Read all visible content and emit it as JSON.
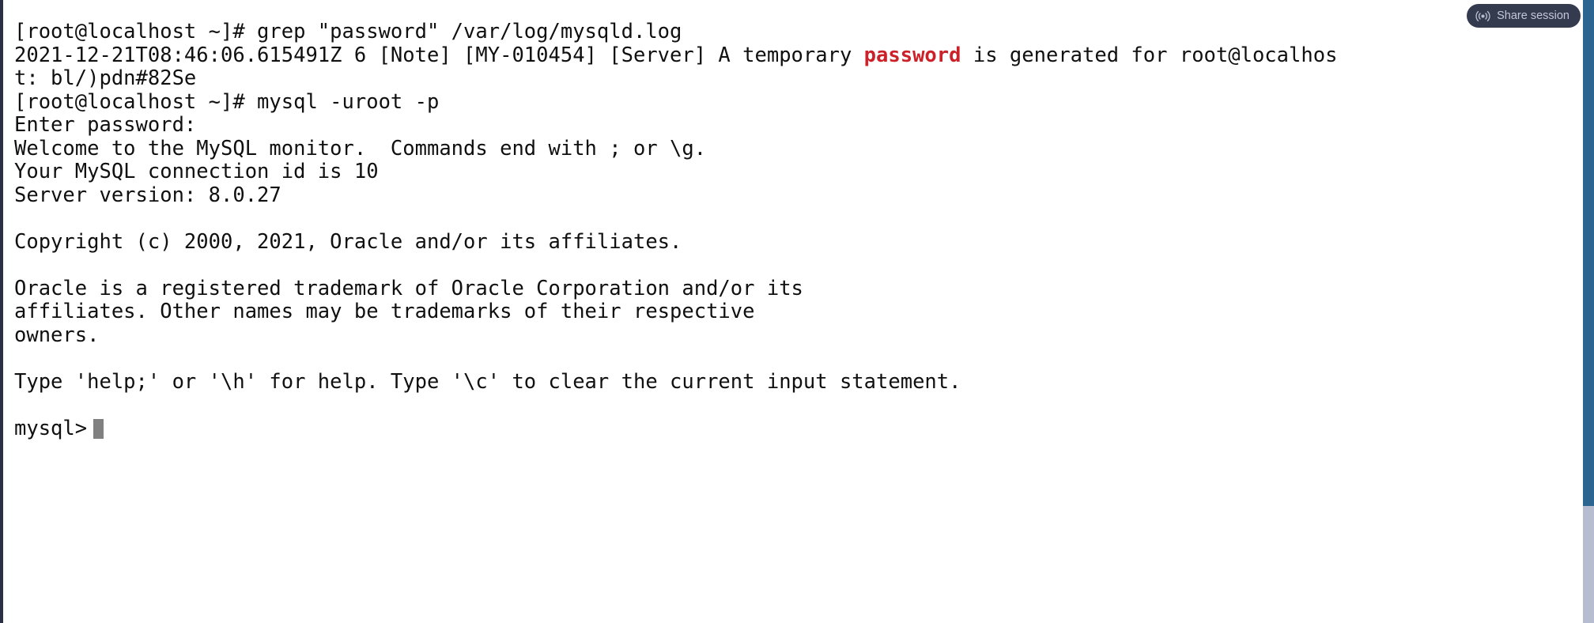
{
  "window": {
    "background_color": "#ffffff",
    "text_color": "#101010",
    "rail_color": "#2b3044",
    "scrollbar_color": "#2d6591",
    "scrollbar_track_color": "#b7bdd0"
  },
  "share_button": {
    "label": "Share session",
    "icon": "broadcast-icon",
    "background_color": "#353b4f",
    "text_color": "#c2c7d8"
  },
  "terminal": {
    "prompt_host": "[root@localhost ~]#",
    "cursor": "block",
    "cursor_color": "#808080",
    "match_highlight_color": "#cc2128",
    "lines": [
      {
        "id": "l0",
        "text": "[root@localhost ~]# grep \"password\" /var/log/mysqld.log"
      },
      {
        "id": "l1",
        "pre": "2021-12-21T08:46:06.615491Z 6 [Note] [MY-010454] [Server] A temporary ",
        "match": "password",
        "post": " is generated for root@localhos"
      },
      {
        "id": "l2",
        "text": "t: bl/)pdn#82Se"
      },
      {
        "id": "l3",
        "text": "[root@localhost ~]# mysql -uroot -p"
      },
      {
        "id": "l4",
        "text": "Enter password:"
      },
      {
        "id": "l5",
        "text": "Welcome to the MySQL monitor.  Commands end with ; or \\g."
      },
      {
        "id": "l6",
        "text": "Your MySQL connection id is 10"
      },
      {
        "id": "l7",
        "text": "Server version: 8.0.27"
      },
      {
        "id": "l8",
        "text": ""
      },
      {
        "id": "l9",
        "text": "Copyright (c) 2000, 2021, Oracle and/or its affiliates."
      },
      {
        "id": "l10",
        "text": ""
      },
      {
        "id": "l11",
        "text": "Oracle is a registered trademark of Oracle Corporation and/or its"
      },
      {
        "id": "l12",
        "text": "affiliates. Other names may be trademarks of their respective"
      },
      {
        "id": "l13",
        "text": "owners."
      },
      {
        "id": "l14",
        "text": ""
      },
      {
        "id": "l15",
        "text": "Type 'help;' or '\\h' for help. Type '\\c' to clear the current input statement."
      },
      {
        "id": "l16",
        "text": ""
      },
      {
        "id": "l17",
        "text": "mysql>"
      }
    ]
  }
}
